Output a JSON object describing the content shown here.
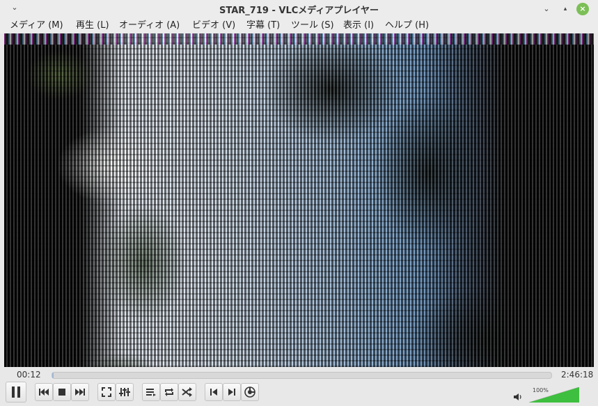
{
  "window": {
    "title": "STAR_719 - VLCメディアプレイヤー"
  },
  "menu": [
    {
      "label": "メディア (M)"
    },
    {
      "label": "再生 (L)"
    },
    {
      "label": "オーディオ (A)"
    },
    {
      "label": "ビデオ (V)"
    },
    {
      "label": "字幕 (T)"
    },
    {
      "label": "ツール (S)"
    },
    {
      "label": "表示 (I)"
    },
    {
      "label": "ヘルプ (H)"
    }
  ],
  "playback": {
    "elapsed": "00:12",
    "total": "2:46:18",
    "progress_fraction": 0.0012
  },
  "volume": {
    "label": "100%",
    "level_percent": 100
  },
  "colors": {
    "close_button": "#7cbf57",
    "volume_fill": "#3fbf3f"
  },
  "icons": [
    "window-menu-icon",
    "minimize-icon",
    "maximize-icon",
    "close-icon",
    "pause-icon",
    "previous-icon",
    "stop-icon",
    "next-icon",
    "fullscreen-icon",
    "extended-settings-icon",
    "playlist-icon",
    "loop-icon",
    "shuffle-icon",
    "frame-back-icon",
    "frame-forward-icon",
    "effects-icon",
    "speaker-icon"
  ]
}
